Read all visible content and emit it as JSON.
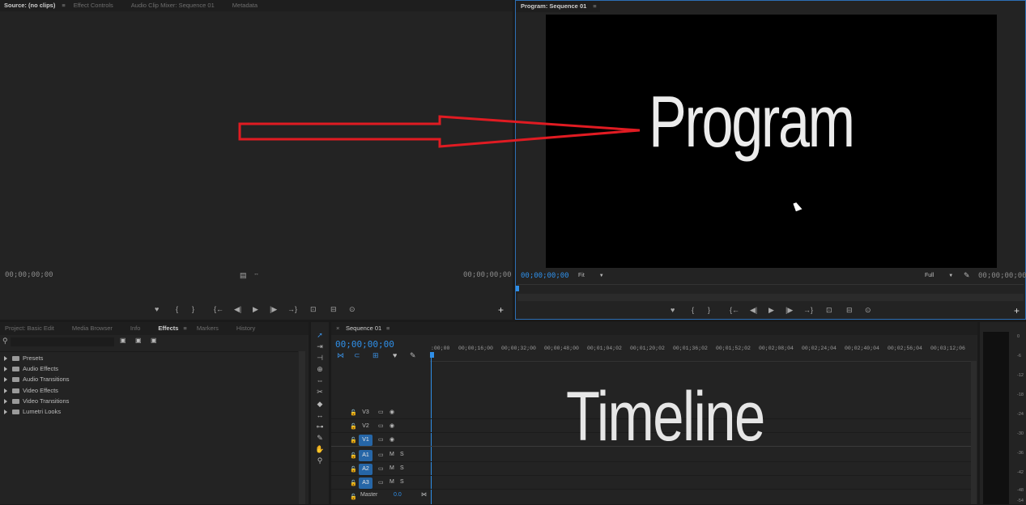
{
  "source": {
    "tabs": [
      "Source: (no clips)",
      "Effect Controls",
      "Audio Clip Mixer: Sequence 01",
      "Metadata"
    ],
    "tc_left": "00;00;00;00",
    "tc_right": "00;00;00;00"
  },
  "program": {
    "tab": "Program: Sequence 01",
    "overlay_text": "Program",
    "tc_left": "00;00;00;00",
    "tc_right": "00;00;00;00",
    "fit_label": "Fit",
    "full_label": "Full"
  },
  "project": {
    "tabs": [
      "Project: Basic Edit",
      "Media Browser",
      "Info",
      "Effects",
      "Markers",
      "History"
    ],
    "tree": [
      "Presets",
      "Audio Effects",
      "Audio Transitions",
      "Video Effects",
      "Video Transitions",
      "Lumetri Looks"
    ]
  },
  "timeline": {
    "tab": "Sequence 01",
    "timecode": "00;00;00;00",
    "overlay_text": "Timeline",
    "ruler": [
      ":00;00",
      "00;00;16;00",
      "00;00;32;00",
      "00;00;48;00",
      "00;01;04;02",
      "00;01;20;02",
      "00;01;36;02",
      "00;01;52;02",
      "00;02;08;04",
      "00;02;24;04",
      "00;02;40;04",
      "00;02;56;04",
      "00;03;12;06"
    ],
    "tracks": [
      {
        "name": "V3",
        "icons": [
          "▭",
          "◉"
        ]
      },
      {
        "name": "V2",
        "icons": [
          "▭",
          "◉"
        ]
      },
      {
        "name": "V1",
        "icons": [
          "▭",
          "◉"
        ]
      },
      {
        "name": "A1",
        "icons": [
          "▭",
          "M",
          "S"
        ]
      },
      {
        "name": "A2",
        "icons": [
          "▭",
          "M",
          "S"
        ]
      },
      {
        "name": "A3",
        "icons": [
          "▭",
          "M",
          "S"
        ]
      }
    ],
    "master_label": "Master",
    "master_value": "0.0"
  },
  "meter": {
    "labels": [
      "0",
      "-6",
      "-12",
      "-18",
      "-24",
      "-30",
      "-36",
      "-42",
      "-48",
      "-54"
    ]
  },
  "colors": {
    "accent": "#2f8fe8",
    "arrow": "#e01b22"
  }
}
